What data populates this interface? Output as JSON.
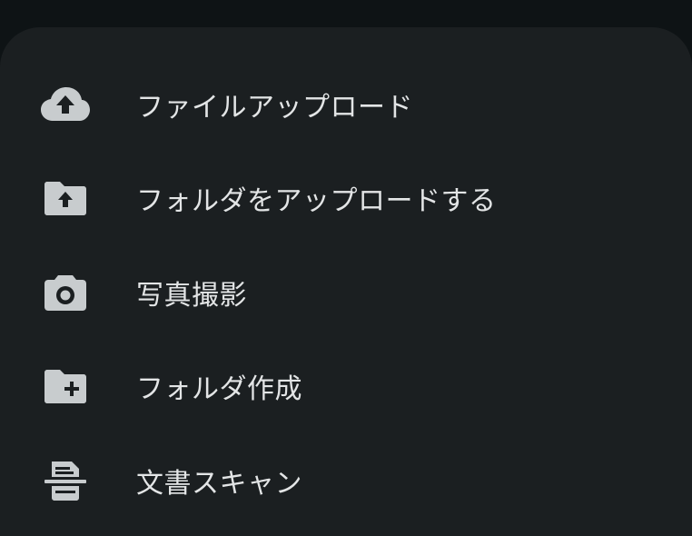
{
  "bottom_sheet": {
    "items": [
      {
        "label": "ファイルアップロード",
        "icon": "cloud-upload-icon"
      },
      {
        "label": "フォルダをアップロードする",
        "icon": "folder-upload-icon"
      },
      {
        "label": "写真撮影",
        "icon": "camera-icon"
      },
      {
        "label": "フォルダ作成",
        "icon": "create-folder-icon"
      },
      {
        "label": "文書スキャン",
        "icon": "document-scan-icon"
      }
    ]
  },
  "colors": {
    "backdrop": "#0e1315",
    "sheet_background": "#1b1f21",
    "text": "#e3e5e6",
    "icon": "#c8ccce"
  }
}
